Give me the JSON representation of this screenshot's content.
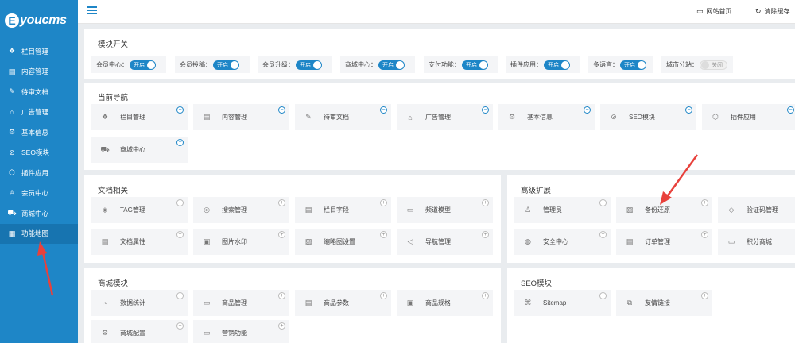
{
  "logo": {
    "mark": "E",
    "text": "youcms"
  },
  "sidebar": {
    "items": [
      {
        "label": "栏目管理",
        "icon": "layers-icon",
        "glyph": "❖"
      },
      {
        "label": "内容管理",
        "icon": "document-icon",
        "glyph": "▤"
      },
      {
        "label": "待审文档",
        "icon": "edit-doc-icon",
        "glyph": "✎"
      },
      {
        "label": "广告管理",
        "icon": "ad-icon",
        "glyph": "⌂"
      },
      {
        "label": "基本信息",
        "icon": "gear-icon",
        "glyph": "⚙"
      },
      {
        "label": "SEO模块",
        "icon": "seo-icon",
        "glyph": "⊘"
      },
      {
        "label": "插件应用",
        "icon": "cube-icon",
        "glyph": "⬡"
      },
      {
        "label": "会员中心",
        "icon": "user-icon",
        "glyph": "♙"
      },
      {
        "label": "商城中心",
        "icon": "cart-icon",
        "glyph": "⛟"
      },
      {
        "label": "功能地图",
        "icon": "grid-icon",
        "glyph": "▦"
      }
    ]
  },
  "topbar": {
    "site_home": "网站首页",
    "clear_cache": "清除缓存"
  },
  "module_switch": {
    "title": "模块开关",
    "on_label": "开启",
    "off_label": "关闭",
    "items": [
      {
        "label": "会员中心：",
        "state": "on"
      },
      {
        "label": "会员投稿：",
        "state": "on"
      },
      {
        "label": "会员升级：",
        "state": "on"
      },
      {
        "label": "商城中心：",
        "state": "on"
      },
      {
        "label": "支付功能：",
        "state": "on"
      },
      {
        "label": "插件应用：",
        "state": "on"
      },
      {
        "label": "多语言：",
        "state": "on"
      },
      {
        "label": "城市分站：",
        "state": "off"
      }
    ]
  },
  "current_nav": {
    "title": "当前导航",
    "items": [
      {
        "label": "栏目管理",
        "glyph": "❖"
      },
      {
        "label": "内容管理",
        "glyph": "▤"
      },
      {
        "label": "待审文档",
        "glyph": "✎"
      },
      {
        "label": "广告管理",
        "glyph": "⌂"
      },
      {
        "label": "基本信息",
        "glyph": "⚙"
      },
      {
        "label": "SEO模块",
        "glyph": "⊘"
      },
      {
        "label": "插件应用",
        "glyph": "⬡"
      },
      {
        "label": "商城中心",
        "glyph": "⛟"
      }
    ]
  },
  "doc_related": {
    "title": "文档相关",
    "items": [
      {
        "label": "TAG管理",
        "glyph": "◈"
      },
      {
        "label": "搜索管理",
        "glyph": "◎"
      },
      {
        "label": "栏目字段",
        "glyph": "▤"
      },
      {
        "label": "频道模型",
        "glyph": "▭"
      },
      {
        "label": "文档属性",
        "glyph": "▤"
      },
      {
        "label": "图片水印",
        "glyph": "▣"
      },
      {
        "label": "缩略图设置",
        "glyph": "▨"
      },
      {
        "label": "导航管理",
        "glyph": "◁"
      }
    ]
  },
  "advanced": {
    "title": "高级扩展",
    "items": [
      {
        "label": "管理员",
        "glyph": "♙"
      },
      {
        "label": "备份还原",
        "glyph": "▨"
      },
      {
        "label": "验证码管理",
        "glyph": "◇"
      },
      {
        "label": "安全中心",
        "glyph": "◍"
      },
      {
        "label": "订单管理",
        "glyph": "▤"
      },
      {
        "label": "积分商城",
        "glyph": "▭"
      }
    ]
  },
  "shop_module": {
    "title": "商城模块",
    "items": [
      {
        "label": "数据统计",
        "glyph": "◔"
      },
      {
        "label": "商品管理",
        "glyph": "▭"
      },
      {
        "label": "商品参数",
        "glyph": "▤"
      },
      {
        "label": "商品规格",
        "glyph": "▣"
      },
      {
        "label": "商城配置",
        "glyph": "⚙"
      },
      {
        "label": "营销功能",
        "glyph": "▭"
      }
    ]
  },
  "seo_module": {
    "title": "SEO模块",
    "items": [
      {
        "label": "Sitemap",
        "glyph": "⌘"
      },
      {
        "label": "友情链接",
        "glyph": "⧉"
      }
    ]
  },
  "colors": {
    "primary": "#1e86c7",
    "active": "#1774b0",
    "annotation": "#e8413c"
  }
}
